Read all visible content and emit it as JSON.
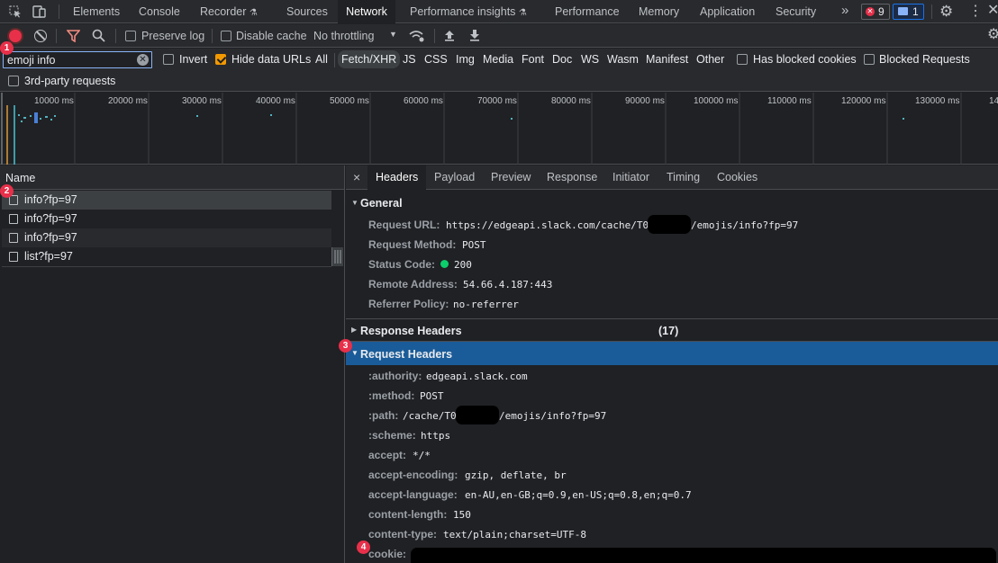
{
  "tabs": [
    "Elements",
    "Console",
    "Recorder",
    "Sources",
    "Network",
    "Performance insights",
    "Performance",
    "Memory",
    "Application",
    "Security"
  ],
  "active_tab": "Network",
  "badges": {
    "errors": "9",
    "messages": "1"
  },
  "toolbar": {
    "preserve_log": "Preserve log",
    "disable_cache": "Disable cache",
    "throttling": "No throttling"
  },
  "filter": {
    "value": "emoji info",
    "invert": "Invert",
    "hide_data_urls": "Hide data URLs",
    "types": [
      "All",
      "Fetch/XHR",
      "JS",
      "CSS",
      "Img",
      "Media",
      "Font",
      "Doc",
      "WS",
      "Wasm",
      "Manifest",
      "Other"
    ],
    "active_type": "Fetch/XHR",
    "has_blocked_cookies": "Has blocked cookies",
    "blocked_requests": "Blocked Requests",
    "third_party": "3rd-party requests"
  },
  "timeline": {
    "ticks": [
      "10000 ms",
      "20000 ms",
      "30000 ms",
      "40000 ms",
      "50000 ms",
      "60000 ms",
      "70000 ms",
      "80000 ms",
      "90000 ms",
      "100000 ms",
      "110000 ms",
      "120000 ms",
      "130000 ms",
      "14"
    ]
  },
  "requests": {
    "column": "Name",
    "items": [
      "info?fp=97",
      "info?fp=97",
      "info?fp=97",
      "list?fp=97"
    ]
  },
  "detail": {
    "close": "×",
    "tabs": [
      "Headers",
      "Payload",
      "Preview",
      "Response",
      "Initiator",
      "Timing",
      "Cookies"
    ],
    "active_tab": "Headers",
    "general": {
      "title": "General",
      "request_url_label": "Request URL:",
      "request_url_prefix": "https://edgeapi.slack.com/cache/T0",
      "request_url_suffix": "/emojis/info?fp=97",
      "request_method_label": "Request Method:",
      "request_method": "POST",
      "status_code_label": "Status Code:",
      "status_code": "200",
      "remote_address_label": "Remote Address:",
      "remote_address": "54.66.4.187:443",
      "referrer_policy_label": "Referrer Policy:",
      "referrer_policy": "no-referrer"
    },
    "response_headers": {
      "title": "Response Headers",
      "count": "(17)"
    },
    "request_headers": {
      "title": "Request Headers",
      "authority_label": ":authority:",
      "authority": "edgeapi.slack.com",
      "method_label": ":method:",
      "method": "POST",
      "path_label": ":path:",
      "path_prefix": "/cache/T0",
      "path_suffix": "/emojis/info?fp=97",
      "scheme_label": ":scheme:",
      "scheme": "https",
      "accept_label": "accept:",
      "accept": "*/*",
      "accept_encoding_label": "accept-encoding:",
      "accept_encoding": "gzip, deflate, br",
      "accept_language_label": "accept-language:",
      "accept_language": "en-AU,en-GB;q=0.9,en-US;q=0.8,en;q=0.7",
      "content_length_label": "content-length:",
      "content_length": "150",
      "content_type_label": "content-type:",
      "content_type": "text/plain;charset=UTF-8",
      "cookie_label": "cookie:"
    }
  },
  "markers": [
    "1",
    "2",
    "3",
    "4"
  ],
  "colors": {
    "accent": "#1a5c99",
    "selected_tab_bg": "#202124",
    "badge": "#e8304a",
    "status_ok": "#0cce6b",
    "checkbox_on": "#f29900"
  }
}
